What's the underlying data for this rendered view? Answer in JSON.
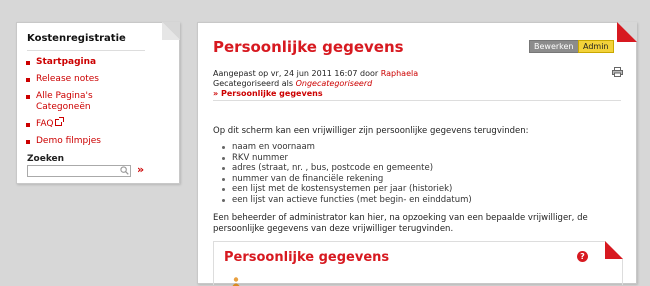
{
  "sidebar": {
    "title": "Kostenregistratie",
    "nav": [
      {
        "label": "Startpagina",
        "active": true
      },
      {
        "label": "Release notes"
      },
      {
        "label": "Alle Pagina's Categoneën"
      },
      {
        "label": "FAQ",
        "icon": "external-link-icon"
      },
      {
        "label": "Demo filmpjes"
      }
    ],
    "search": {
      "label": "Zoeken",
      "value": "",
      "placeholder": "",
      "go": "»"
    }
  },
  "main": {
    "title": "Persoonlijke gegevens",
    "buttons": {
      "edit": "Bewerken",
      "admin": "Admin"
    },
    "meta": {
      "modified_prefix": "Aangepast op vr, 24 jun 2011 16:07 door",
      "author": "Raphaela",
      "category_prefix": "Gecategoriseerd als",
      "category": "Ongecategoriseerd"
    },
    "breadcrumb": "» Persoonlijke gegevens",
    "intro": "Op dit scherm kan een vrijwilliger zijn persoonlijke gegevens terugvinden:",
    "features": [
      "naam en voornaam",
      "RKV nummer",
      "adres (straat, nr. , bus, postcode en gemeente)",
      "nummer van de financiële rekening",
      "een lijst met de kostensystemen per jaar (historiek)",
      "een lijst van actieve functies (met begin- en einddatum)"
    ],
    "admin_note": "Een beheerder of administrator kan hier, na opzoeking van een bepaalde vrijwilliger, de persoonlijke gegevens van deze vrijwilliger terugvinden.",
    "section_title": "Persoonlijke gegevens",
    "help": "?"
  },
  "colors": {
    "accent": "#d71920",
    "link": "#cc0000",
    "admin_button": "#f3d23a",
    "edit_button": "#8c8c8c",
    "background": "#d7d7d7"
  }
}
